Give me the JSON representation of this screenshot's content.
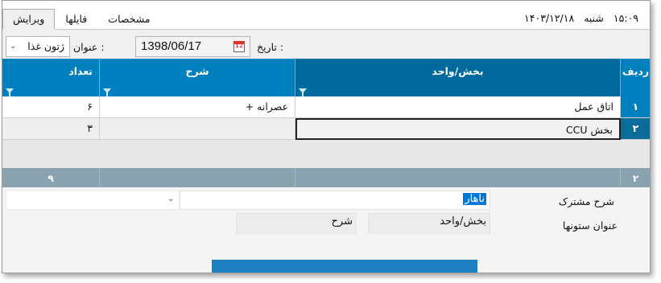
{
  "window": {
    "tabs": [
      {
        "label": "ویرایش",
        "active": true
      },
      {
        "label": "فایلها",
        "active": false
      },
      {
        "label": "مشخصات",
        "active": false
      }
    ],
    "time": "۱۵:۰۹",
    "day": "شنبه",
    "date_hijri": "۱۴۰۳/۱۲/۱۸"
  },
  "form": {
    "date_label": "تاریخ :",
    "date_value": "1398/06/17",
    "title_label": "عنوان :",
    "title_value": "ژتون غذا"
  },
  "grid": {
    "columns": [
      "ردیف",
      "بخش/واحد",
      "شرح",
      "تعداد"
    ],
    "rows": [
      {
        "index": "۱",
        "unit": "اتاق عمل",
        "desc": "عصرانه +",
        "count": "۶"
      },
      {
        "index": "۲",
        "unit": "بخش CCU",
        "desc": "",
        "count": "۳"
      }
    ],
    "footer": {
      "index": "۲",
      "count": "۹"
    }
  },
  "bottom": {
    "common_desc_label": "شرح مشترک",
    "common_desc_value": "ناهار",
    "column_titles_label": "عنوان ستونها",
    "col_title_unit": "بخش/واحد",
    "col_title_desc": "شرح"
  },
  "colors": {
    "header_blue": "#0080bf",
    "selected_blue": "#006a9e",
    "footer_gray": "#8aa3b0"
  }
}
